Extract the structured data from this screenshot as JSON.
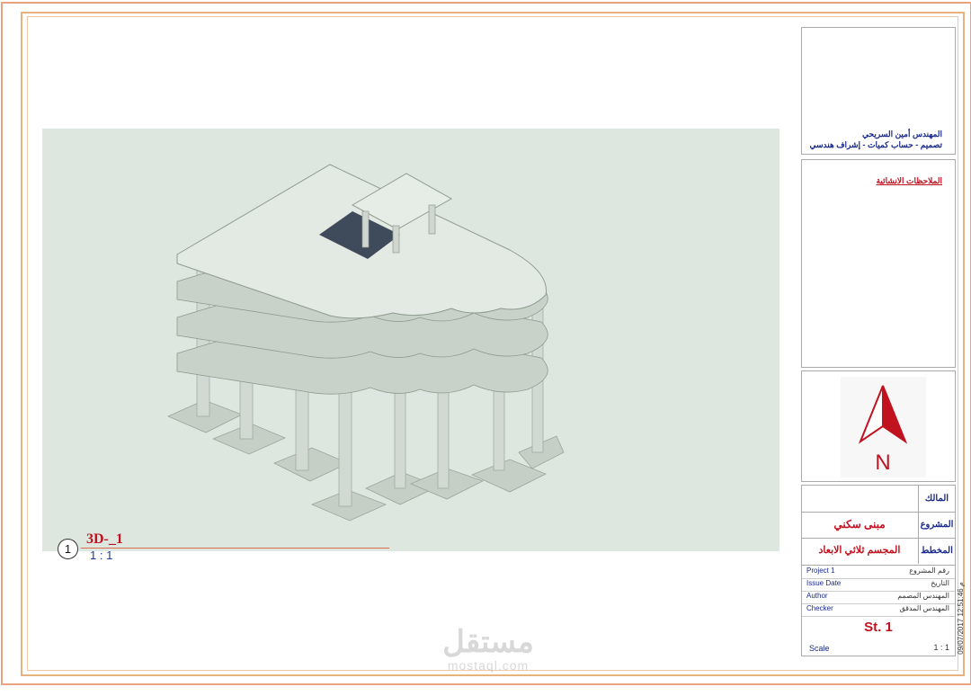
{
  "viewport": {
    "view_number": "1",
    "view_name": "3D-_1",
    "view_scale": "1 : 1"
  },
  "title_block": {
    "engineer_name": "المهندس أمين السريحي",
    "engineer_services": "تصميم - حساب كميات - إشراف هندسي",
    "notes_title": "الملاحظات الانشائية",
    "north_label": "N",
    "owner_label": "المالك",
    "owner_value": "",
    "project_label": "المشروع",
    "project_value": "مبنى سكني",
    "drawing_label": "المخطط",
    "drawing_value": "المجسم ثلاثي الابعاد",
    "meta": [
      {
        "en": "Project 1",
        "ar": "رقم المشروع"
      },
      {
        "en": "Issue Date",
        "ar": "التاريخ"
      },
      {
        "en": "Author",
        "ar": "المهندس المصمم"
      },
      {
        "en": "Checker",
        "ar": "المهندس المدقق"
      }
    ],
    "sheet_number": "St. 1",
    "scale_label": "Scale",
    "scale_value": "1 : 1",
    "timestamp": "09/07/2017 12:51:46 م"
  },
  "watermark": {
    "arabic": "مستقل",
    "latin": "mostaql.com"
  },
  "colors": {
    "accent_red": "#c1121f",
    "label_blue": "#1a2a8c",
    "view_background": "#dde6df"
  }
}
